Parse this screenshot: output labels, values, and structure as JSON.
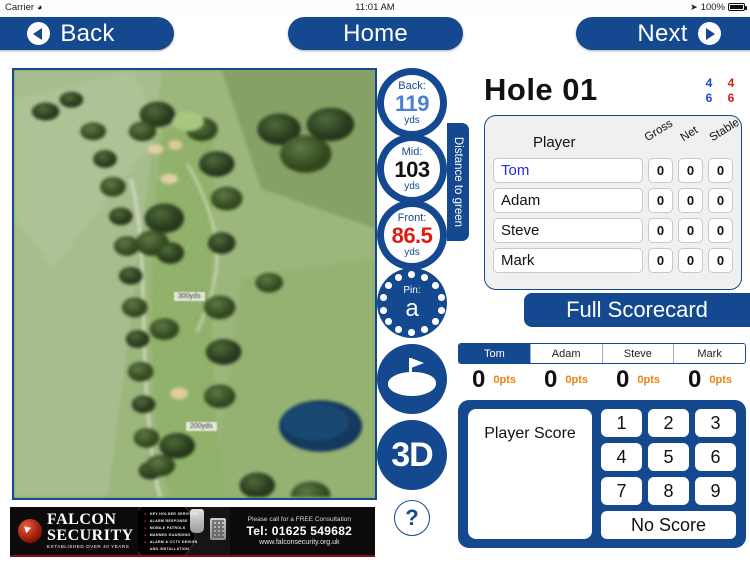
{
  "statusbar": {
    "carrier": "Carrier",
    "wifi_icon": "wifi-icon",
    "time": "11:01 AM",
    "location_icon": "location-arrow-icon",
    "battery": "100%",
    "battery_icon": "battery-full-icon"
  },
  "topnav": {
    "back_label": "Back",
    "home_label": "Home",
    "next_label": "Next",
    "back_icon": "circle-left-arrow-icon",
    "next_icon": "circle-right-arrow-icon"
  },
  "map": {
    "markers": [
      {
        "label": "300yds"
      },
      {
        "label": "200yds"
      }
    ]
  },
  "distances": {
    "tab_label": "Distance to green",
    "unit": "yds",
    "items": [
      {
        "label": "Back:",
        "value": "119",
        "unit": "yds",
        "color": "#4a7fd4"
      },
      {
        "label": "Mid:",
        "value": "103",
        "unit": "yds",
        "color": "#111111"
      },
      {
        "label": "Front:",
        "value": "86.5",
        "unit": "yds",
        "color": "#e01b12"
      }
    ],
    "pin": {
      "label": "Pin:",
      "value": "a",
      "icon": "golf-ball-icon"
    },
    "green_icon": "green-flag-icon",
    "threed_label": "3D",
    "help_label": "?"
  },
  "hole": {
    "title": "Hole 01",
    "par_grid": [
      {
        "blue": "4",
        "red": "4"
      },
      {
        "blue": "6",
        "red": "6"
      }
    ]
  },
  "scorecard": {
    "columns": {
      "player": "Player",
      "gross": "Gross",
      "net": "Net",
      "stable": "Stable"
    },
    "rows": [
      {
        "name": "Tom",
        "gross": "0",
        "net": "0",
        "stable": "0",
        "active": true
      },
      {
        "name": "Adam",
        "gross": "0",
        "net": "0",
        "stable": "0",
        "active": false
      },
      {
        "name": "Steve",
        "gross": "0",
        "net": "0",
        "stable": "0",
        "active": false
      },
      {
        "name": "Mark",
        "gross": "0",
        "net": "0",
        "stable": "0",
        "active": false
      }
    ],
    "full_scorecard_label": "Full Scorecard"
  },
  "player_tabs": [
    {
      "label": "Tom",
      "score": "0",
      "points": "0pts",
      "selected": true
    },
    {
      "label": "Adam",
      "score": "0",
      "points": "0pts",
      "selected": false
    },
    {
      "label": "Steve",
      "score": "0",
      "points": "0pts",
      "selected": false
    },
    {
      "label": "Mark",
      "score": "0",
      "points": "0pts",
      "selected": false
    }
  ],
  "keypad": {
    "score_placeholder": "Player Score",
    "keys": [
      "1",
      "2",
      "3",
      "4",
      "5",
      "6",
      "7",
      "8",
      "9"
    ],
    "no_score_label": "No Score"
  },
  "ad": {
    "brand_line1": "FALCON",
    "brand_line2": "SECURITY",
    "brand_tagline": "ESTABLISHED OVER 40 YEARS",
    "bullets": [
      "KEY HOLDER SERVICES",
      "ALARM RESPONSE",
      "MOBILE PATROLS",
      "MANNED GUARDING",
      "ALARM & CCTV DESIGN AND INSTALLATION"
    ],
    "cta": "Please call for a FREE Consultation",
    "phone": "Tel: 01625 549682",
    "website": "www.falconsecurity.org.uk"
  },
  "colors": {
    "brand_blue": "#14488f",
    "accent_orange": "#e8820c",
    "front_red": "#e01b12",
    "back_blue": "#4a7fd4"
  }
}
